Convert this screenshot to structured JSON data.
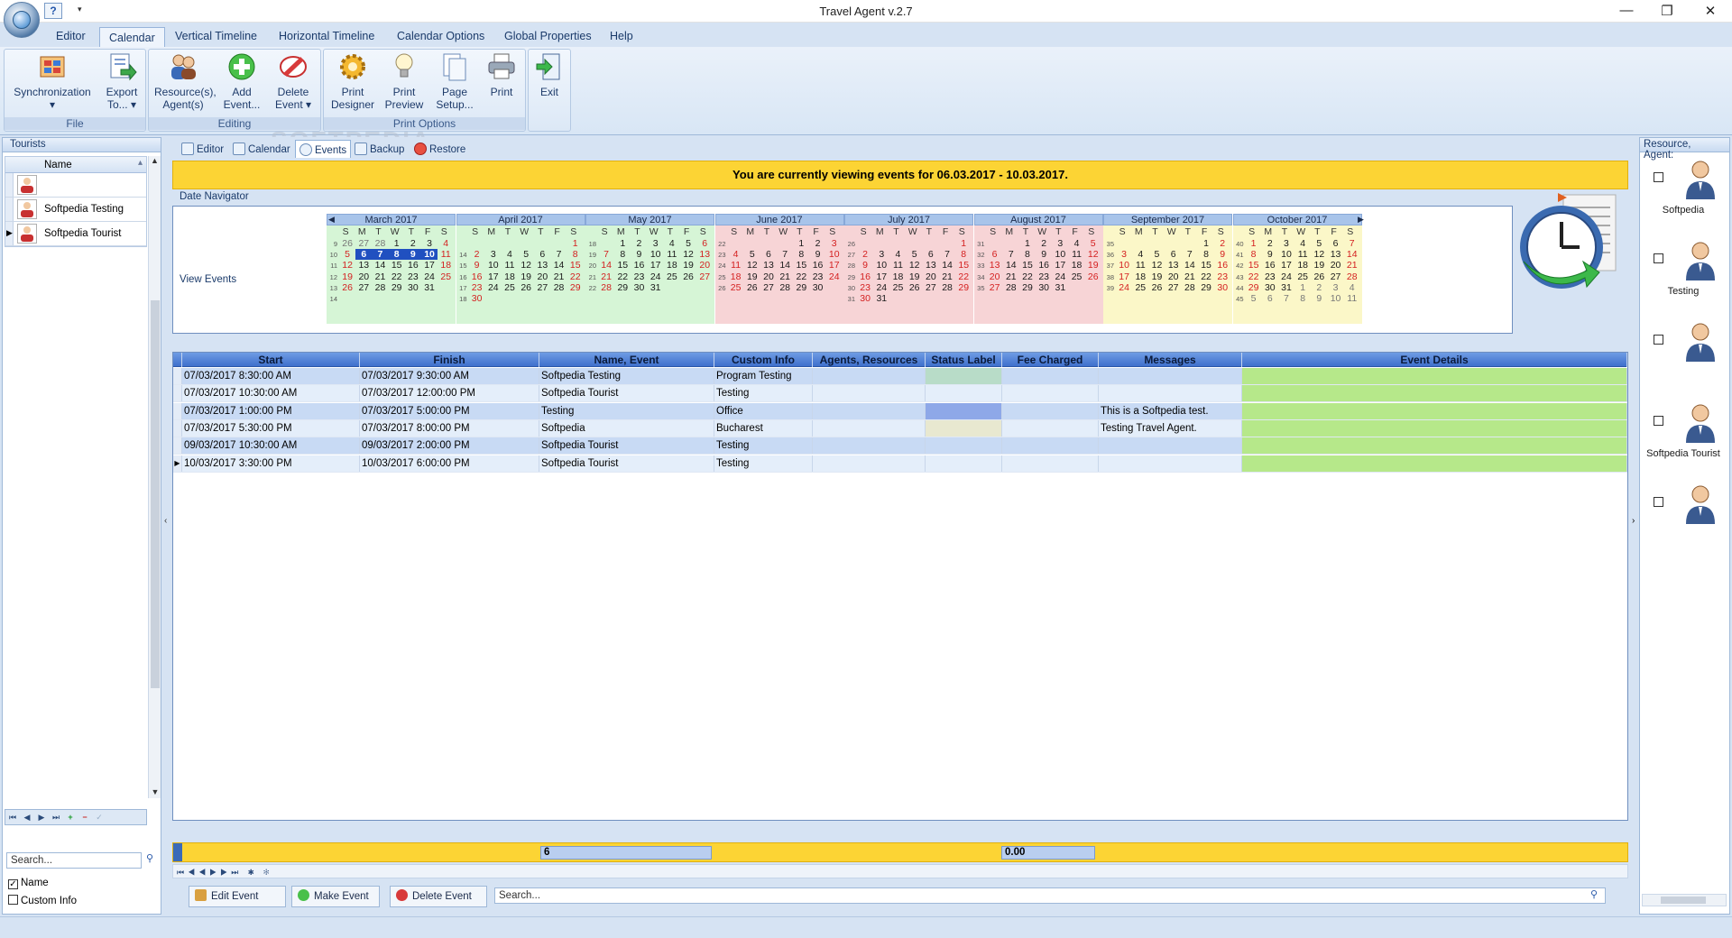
{
  "app": {
    "title": "Travel Agent v.2.7"
  },
  "window_controls": {
    "minimize": "—",
    "maximize": "❐",
    "close": "✕"
  },
  "quick_access": {
    "help": "?",
    "dropdown": "▾"
  },
  "menu": {
    "tabs": [
      "Editor",
      "Calendar",
      "Vertical Timeline",
      "Horizontal Timeline",
      "Calendar Options",
      "Global Properties",
      "Help"
    ],
    "active": "Calendar"
  },
  "ribbon": {
    "groups": [
      {
        "label": "File",
        "buttons": [
          {
            "label1": "Synchronization",
            "label2": "▾",
            "icon": "sync-icon"
          },
          {
            "label1": "Export",
            "label2": "To... ▾",
            "icon": "export-icon"
          }
        ]
      },
      {
        "label": "Editing",
        "buttons": [
          {
            "label1": "Resource(s),",
            "label2": "Agent(s)",
            "icon": "people-icon"
          },
          {
            "label1": "Add",
            "label2": "Event...",
            "icon": "add-icon"
          },
          {
            "label1": "Delete",
            "label2": "Event ▾",
            "icon": "delete-icon"
          }
        ]
      },
      {
        "label": "Print Options",
        "buttons": [
          {
            "label1": "Print",
            "label2": "Designer",
            "icon": "gear-icon"
          },
          {
            "label1": "Print",
            "label2": "Preview",
            "icon": "bulb-icon"
          },
          {
            "label1": "Page",
            "label2": "Setup...",
            "icon": "page-icon"
          },
          {
            "label1": "Print",
            "label2": "",
            "icon": "printer-icon"
          }
        ]
      },
      {
        "label": "",
        "buttons": [
          {
            "label1": "Exit",
            "label2": "",
            "icon": "exit-icon"
          }
        ]
      }
    ],
    "watermark": "SOFTPEDIA"
  },
  "left_panel": {
    "title": "Tourists",
    "column_name": "Name",
    "rows": [
      "",
      "Softpedia Testing",
      "Softpedia Tourist"
    ],
    "nav_buttons": [
      "⏮",
      "◀",
      "▶",
      "⏭",
      "+",
      "−",
      "✓"
    ],
    "search_placeholder": "Search...",
    "checkboxes": [
      {
        "label": "Name",
        "checked": true
      },
      {
        "label": "Custom Info",
        "checked": false
      }
    ]
  },
  "subtabs": [
    "Editor",
    "Calendar",
    "Events",
    "Backup",
    "Restore"
  ],
  "active_subtab": "Events",
  "banner": "You are currently viewing events for 06.03.2017 - 10.03.2017.",
  "date_navigator": {
    "label": "Date Navigator",
    "day_headers": [
      "S",
      "M",
      "T",
      "W",
      "T",
      "F",
      "S"
    ],
    "months": [
      {
        "name": "March 2017",
        "weeks": [
          "9",
          "10",
          "11",
          "12",
          "13",
          "14"
        ],
        "days": [
          [
            "26",
            "27",
            "28",
            "1",
            "2",
            "3",
            "4"
          ],
          [
            "5",
            "6",
            "7",
            "8",
            "9",
            "10",
            "11"
          ],
          [
            "12",
            "13",
            "14",
            "15",
            "16",
            "17",
            "18"
          ],
          [
            "19",
            "20",
            "21",
            "22",
            "23",
            "24",
            "25"
          ],
          [
            "26",
            "27",
            "28",
            "29",
            "30",
            "31",
            ""
          ],
          [
            "",
            "",
            "",
            "",
            "",
            "",
            ""
          ]
        ]
      },
      {
        "name": "April 2017",
        "weeks": [
          "",
          "14",
          "15",
          "16",
          "17",
          "18"
        ],
        "days": [
          [
            "",
            "",
            "",
            "",
            "",
            "",
            "1"
          ],
          [
            "2",
            "3",
            "4",
            "5",
            "6",
            "7",
            "8"
          ],
          [
            "9",
            "10",
            "11",
            "12",
            "13",
            "14",
            "15"
          ],
          [
            "16",
            "17",
            "18",
            "19",
            "20",
            "21",
            "22"
          ],
          [
            "23",
            "24",
            "25",
            "26",
            "27",
            "28",
            "29"
          ],
          [
            "30",
            "",
            "",
            "",
            "",
            "",
            ""
          ]
        ]
      },
      {
        "name": "May 2017",
        "weeks": [
          "18",
          "19",
          "20",
          "21",
          "22",
          ""
        ],
        "days": [
          [
            "",
            "1",
            "2",
            "3",
            "4",
            "5",
            "6"
          ],
          [
            "7",
            "8",
            "9",
            "10",
            "11",
            "12",
            "13"
          ],
          [
            "14",
            "15",
            "16",
            "17",
            "18",
            "19",
            "20"
          ],
          [
            "21",
            "22",
            "23",
            "24",
            "25",
            "26",
            "27"
          ],
          [
            "28",
            "29",
            "30",
            "31",
            "",
            "",
            ""
          ],
          [
            "",
            "",
            "",
            "",
            "",
            "",
            ""
          ]
        ]
      },
      {
        "name": "June 2017",
        "weeks": [
          "22",
          "23",
          "24",
          "25",
          "26",
          ""
        ],
        "days": [
          [
            "",
            "",
            "",
            "",
            "1",
            "2",
            "3"
          ],
          [
            "4",
            "5",
            "6",
            "7",
            "8",
            "9",
            "10"
          ],
          [
            "11",
            "12",
            "13",
            "14",
            "15",
            "16",
            "17"
          ],
          [
            "18",
            "19",
            "20",
            "21",
            "22",
            "23",
            "24"
          ],
          [
            "25",
            "26",
            "27",
            "28",
            "29",
            "30",
            ""
          ],
          [
            "",
            "",
            "",
            "",
            "",
            "",
            ""
          ]
        ]
      },
      {
        "name": "July 2017",
        "weeks": [
          "26",
          "27",
          "28",
          "29",
          "30",
          "31"
        ],
        "days": [
          [
            "",
            "",
            "",
            "",
            "",
            "",
            "1"
          ],
          [
            "2",
            "3",
            "4",
            "5",
            "6",
            "7",
            "8"
          ],
          [
            "9",
            "10",
            "11",
            "12",
            "13",
            "14",
            "15"
          ],
          [
            "16",
            "17",
            "18",
            "19",
            "20",
            "21",
            "22"
          ],
          [
            "23",
            "24",
            "25",
            "26",
            "27",
            "28",
            "29"
          ],
          [
            "30",
            "31",
            "",
            "",
            "",
            "",
            ""
          ]
        ]
      },
      {
        "name": "August 2017",
        "weeks": [
          "31",
          "32",
          "33",
          "34",
          "35",
          ""
        ],
        "days": [
          [
            "",
            "",
            "1",
            "2",
            "3",
            "4",
            "5"
          ],
          [
            "6",
            "7",
            "8",
            "9",
            "10",
            "11",
            "12"
          ],
          [
            "13",
            "14",
            "15",
            "16",
            "17",
            "18",
            "19"
          ],
          [
            "20",
            "21",
            "22",
            "23",
            "24",
            "25",
            "26"
          ],
          [
            "27",
            "28",
            "29",
            "30",
            "31",
            "",
            ""
          ],
          [
            "",
            "",
            "",
            "",
            "",
            "",
            ""
          ]
        ]
      },
      {
        "name": "September 2017",
        "weeks": [
          "35",
          "36",
          "37",
          "38",
          "39",
          ""
        ],
        "days": [
          [
            "",
            "",
            "",
            "",
            "",
            "1",
            "2"
          ],
          [
            "3",
            "4",
            "5",
            "6",
            "7",
            "8",
            "9"
          ],
          [
            "10",
            "11",
            "12",
            "13",
            "14",
            "15",
            "16"
          ],
          [
            "17",
            "18",
            "19",
            "20",
            "21",
            "22",
            "23"
          ],
          [
            "24",
            "25",
            "26",
            "27",
            "28",
            "29",
            "30"
          ],
          [
            "",
            "",
            "",
            "",
            "",
            "",
            ""
          ]
        ]
      },
      {
        "name": "October 2017",
        "weeks": [
          "40",
          "41",
          "42",
          "43",
          "44",
          "45"
        ],
        "days": [
          [
            "1",
            "2",
            "3",
            "4",
            "5",
            "6",
            "7"
          ],
          [
            "8",
            "9",
            "10",
            "11",
            "12",
            "13",
            "14"
          ],
          [
            "15",
            "16",
            "17",
            "18",
            "19",
            "20",
            "21"
          ],
          [
            "22",
            "23",
            "24",
            "25",
            "26",
            "27",
            "28"
          ],
          [
            "29",
            "30",
            "31",
            "1",
            "2",
            "3",
            "4"
          ],
          [
            "5",
            "6",
            "7",
            "8",
            "9",
            "10",
            "11"
          ]
        ]
      }
    ]
  },
  "view_events": {
    "label": "View Events",
    "columns": [
      "Start",
      "Finish",
      "Name, Event",
      "Custom Info",
      "Agents, Resources",
      "Status Label",
      "Fee Charged",
      "Messages",
      "Event Details"
    ],
    "rows": [
      {
        "start": "07/03/2017 8:30:00 AM",
        "finish": "07/03/2017 9:30:00 AM",
        "name": "Softpedia Testing",
        "custom": "Program Testing",
        "agents": "",
        "status_color": "#b8dcc8",
        "fee": "",
        "messages": "",
        "details": ""
      },
      {
        "start": "07/03/2017 10:30:00 AM",
        "finish": "07/03/2017 12:00:00 PM",
        "name": "Softpedia Tourist",
        "custom": "Testing",
        "agents": "",
        "status_color": "",
        "fee": "",
        "messages": "",
        "details": ""
      },
      {
        "start": "07/03/2017 1:00:00 PM",
        "finish": "07/03/2017 5:00:00 PM",
        "name": "Testing",
        "custom": "Office",
        "agents": "",
        "status_color": "#8ea8e8",
        "fee": "",
        "messages": "This is a Softpedia test.",
        "details": ""
      },
      {
        "start": "07/03/2017 5:30:00 PM",
        "finish": "07/03/2017 8:00:00 PM",
        "name": "Softpedia",
        "custom": "Bucharest",
        "agents": "",
        "status_color": "#e8e8d0",
        "fee": "",
        "messages": "Testing Travel Agent.",
        "details": ""
      },
      {
        "start": "09/03/2017 10:30:00 AM",
        "finish": "09/03/2017 2:00:00 PM",
        "name": "Softpedia Tourist",
        "custom": "Testing",
        "agents": "",
        "status_color": "",
        "fee": "",
        "messages": "",
        "details": ""
      },
      {
        "start": "10/03/2017 3:30:00 PM",
        "finish": "10/03/2017 6:00:00 PM",
        "name": "Softpedia Tourist",
        "custom": "Testing",
        "agents": "",
        "status_color": "",
        "fee": "",
        "messages": "",
        "details": ""
      }
    ],
    "summary_count": "6",
    "summary_fee": "0.00"
  },
  "bottom_actions": {
    "edit": "Edit Event",
    "make": "Make Event",
    "delete": "Delete Event",
    "search_placeholder": "Search..."
  },
  "right_panel": {
    "title": "Resource, Agent:",
    "resources": [
      "Softpedia",
      "Testing",
      "",
      "Softpedia Tourist",
      ""
    ]
  },
  "colors": {
    "accent": "#fcd434",
    "selected_row": "#c8daf4",
    "alt_row": "#e4eefa",
    "weekend": "#d42020",
    "month_green": "#d6f5d6",
    "month_pink": "#f7d4d6",
    "month_yellow": "#fbf7c8"
  }
}
